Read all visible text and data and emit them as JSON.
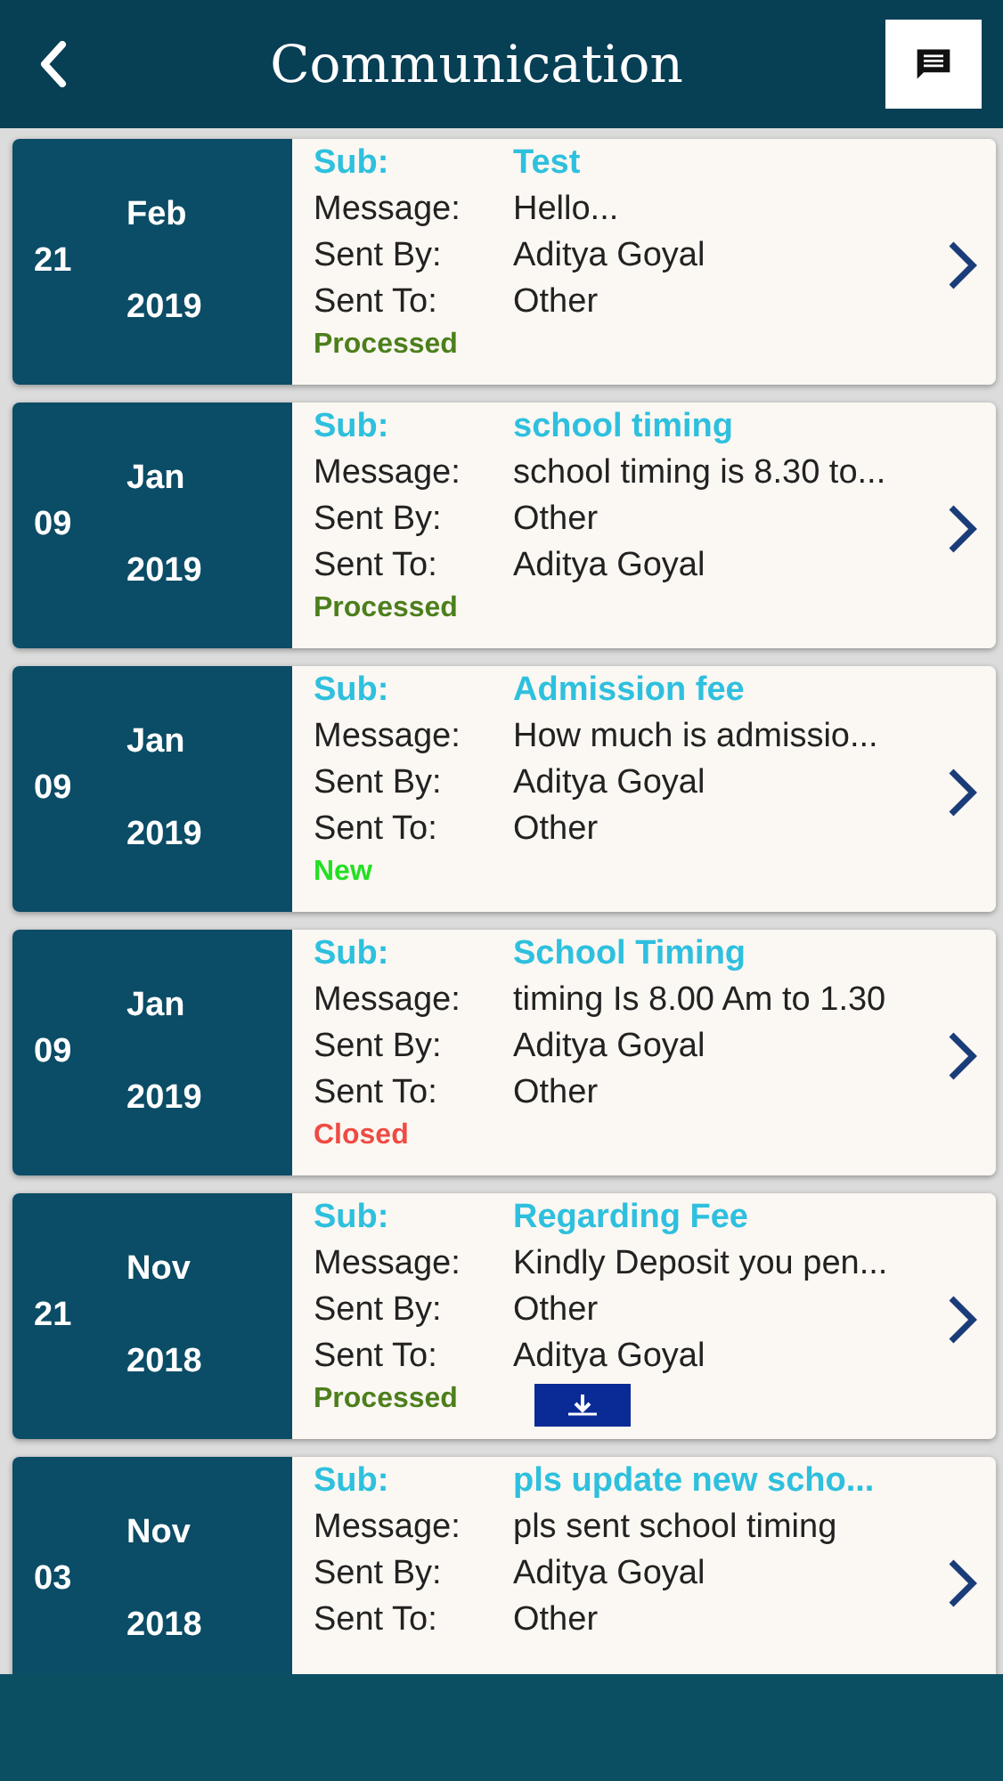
{
  "header": {
    "title": "Communication"
  },
  "messages": [
    {
      "day": "21",
      "month": "Feb",
      "year": "2019",
      "sub_label": "Sub:",
      "subject": "Test",
      "message_label": "Message:",
      "message": "Hello...",
      "sent_by_label": "Sent By:",
      "sent_by": "Aditya Goyal",
      "sent_to_label": "Sent To:",
      "sent_to": "Other",
      "status": "Processed",
      "kind": "processed",
      "attachment": false
    },
    {
      "day": "09",
      "month": "Jan",
      "year": "2019",
      "sub_label": "Sub:",
      "subject": "school timing",
      "message_label": "Message:",
      "message": "school timing is 8.30 to...",
      "sent_by_label": "Sent By:",
      "sent_by": "Other",
      "sent_to_label": "Sent To:",
      "sent_to": "Aditya Goyal",
      "status": "Processed",
      "kind": "processed",
      "attachment": false
    },
    {
      "day": "09",
      "month": "Jan",
      "year": "2019",
      "sub_label": "Sub:",
      "subject": "Admission fee",
      "message_label": "Message:",
      "message": "How much is admissio...",
      "sent_by_label": "Sent By:",
      "sent_by": "Aditya Goyal",
      "sent_to_label": "Sent To:",
      "sent_to": "Other",
      "status": "New",
      "kind": "new",
      "attachment": false
    },
    {
      "day": "09",
      "month": "Jan",
      "year": "2019",
      "sub_label": "Sub:",
      "subject": "School Timing",
      "message_label": "Message:",
      "message": "timing Is 8.00 Am to 1.30",
      "sent_by_label": "Sent By:",
      "sent_by": "Aditya Goyal",
      "sent_to_label": "Sent To:",
      "sent_to": "Other",
      "status": "Closed",
      "kind": "closed",
      "attachment": false
    },
    {
      "day": "21",
      "month": "Nov",
      "year": "2018",
      "sub_label": "Sub:",
      "subject": "Regarding Fee",
      "message_label": "Message:",
      "message": "Kindly Deposit you pen...",
      "sent_by_label": "Sent By:",
      "sent_by": "Other",
      "sent_to_label": "Sent To:",
      "sent_to": "Aditya Goyal",
      "status": "Processed",
      "kind": "processed",
      "attachment": true
    },
    {
      "day": "03",
      "month": "Nov",
      "year": "2018",
      "sub_label": "Sub:",
      "subject": "pls update new scho...",
      "message_label": "Message:",
      "message": "pls sent school timing",
      "sent_by_label": "Sent By:",
      "sent_by": "Aditya Goyal",
      "sent_to_label": "Sent To:",
      "sent_to": "Other",
      "attachment": false
    }
  ]
}
